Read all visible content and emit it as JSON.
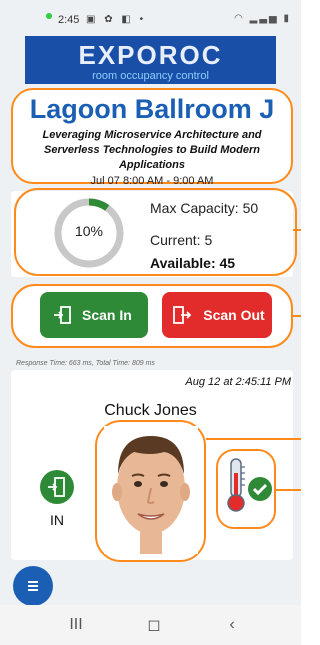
{
  "status_bar": {
    "time": "2:45",
    "icons": "▣ ✿ ◧ •",
    "right_icons": "◠ ▂▃▅ ▮"
  },
  "logo": {
    "title": "EXPOROC",
    "subtitle": "room occupancy control"
  },
  "room": {
    "name": "Lagoon Ballroom J",
    "description": "Leveraging Microservice Architecture and Serverless Technologies to Build Modern Applications",
    "schedule": "Jul 07 8:00 AM - 9:00 AM"
  },
  "capacity": {
    "percent_label": "10%",
    "percent_value": 0.1,
    "max_label": "Max Capacity: 50",
    "current_label": "Current: 5",
    "available_label": "Available: 45",
    "colors": {
      "track": "#c8c8c8",
      "fill": "#2f8a38"
    }
  },
  "scan": {
    "in_label": "Scan In",
    "out_label": "Scan Out",
    "in_color": "#2f8a38",
    "out_color": "#e22b2b"
  },
  "response_info": "Response Time: 663 ms, Total Time: 809 ms",
  "person": {
    "timestamp": "Aug 12 at 2:45:11 PM",
    "name": "Chuck Jones",
    "direction": "IN",
    "photo_icon": "face-photo",
    "temperature_icon": "thermometer-icon",
    "temperature_status_icon": "check-icon"
  },
  "fab_icon": "menu-icon",
  "nav": {
    "recents": "III",
    "home": "◻",
    "back": "‹"
  },
  "accent_color": "#ff8a1c"
}
